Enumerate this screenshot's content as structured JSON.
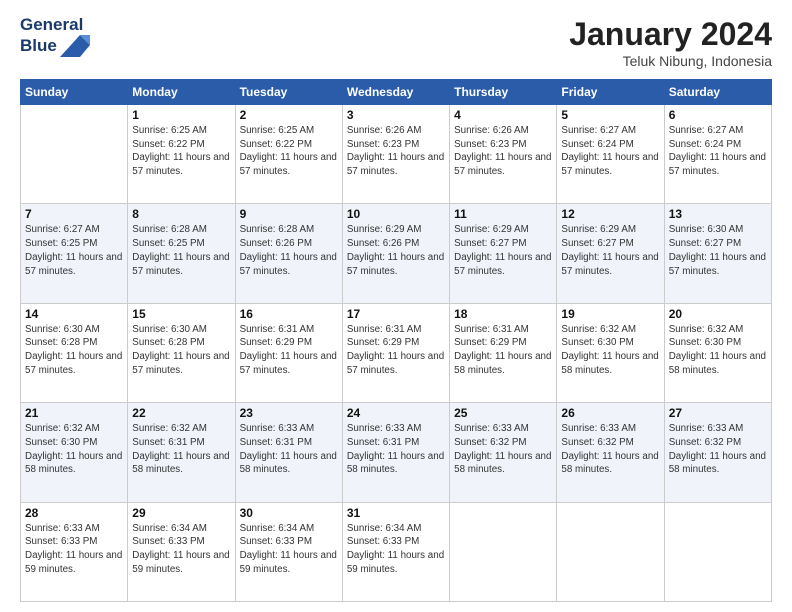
{
  "header": {
    "logo_line1": "General",
    "logo_line2": "Blue",
    "month": "January 2024",
    "location": "Teluk Nibung, Indonesia"
  },
  "days_of_week": [
    "Sunday",
    "Monday",
    "Tuesday",
    "Wednesday",
    "Thursday",
    "Friday",
    "Saturday"
  ],
  "weeks": [
    [
      {
        "day": "",
        "sunrise": "",
        "sunset": "",
        "daylight": ""
      },
      {
        "day": "1",
        "sunrise": "Sunrise: 6:25 AM",
        "sunset": "Sunset: 6:22 PM",
        "daylight": "Daylight: 11 hours and 57 minutes."
      },
      {
        "day": "2",
        "sunrise": "Sunrise: 6:25 AM",
        "sunset": "Sunset: 6:22 PM",
        "daylight": "Daylight: 11 hours and 57 minutes."
      },
      {
        "day": "3",
        "sunrise": "Sunrise: 6:26 AM",
        "sunset": "Sunset: 6:23 PM",
        "daylight": "Daylight: 11 hours and 57 minutes."
      },
      {
        "day": "4",
        "sunrise": "Sunrise: 6:26 AM",
        "sunset": "Sunset: 6:23 PM",
        "daylight": "Daylight: 11 hours and 57 minutes."
      },
      {
        "day": "5",
        "sunrise": "Sunrise: 6:27 AM",
        "sunset": "Sunset: 6:24 PM",
        "daylight": "Daylight: 11 hours and 57 minutes."
      },
      {
        "day": "6",
        "sunrise": "Sunrise: 6:27 AM",
        "sunset": "Sunset: 6:24 PM",
        "daylight": "Daylight: 11 hours and 57 minutes."
      }
    ],
    [
      {
        "day": "7",
        "sunrise": "Sunrise: 6:27 AM",
        "sunset": "Sunset: 6:25 PM",
        "daylight": "Daylight: 11 hours and 57 minutes."
      },
      {
        "day": "8",
        "sunrise": "Sunrise: 6:28 AM",
        "sunset": "Sunset: 6:25 PM",
        "daylight": "Daylight: 11 hours and 57 minutes."
      },
      {
        "day": "9",
        "sunrise": "Sunrise: 6:28 AM",
        "sunset": "Sunset: 6:26 PM",
        "daylight": "Daylight: 11 hours and 57 minutes."
      },
      {
        "day": "10",
        "sunrise": "Sunrise: 6:29 AM",
        "sunset": "Sunset: 6:26 PM",
        "daylight": "Daylight: 11 hours and 57 minutes."
      },
      {
        "day": "11",
        "sunrise": "Sunrise: 6:29 AM",
        "sunset": "Sunset: 6:27 PM",
        "daylight": "Daylight: 11 hours and 57 minutes."
      },
      {
        "day": "12",
        "sunrise": "Sunrise: 6:29 AM",
        "sunset": "Sunset: 6:27 PM",
        "daylight": "Daylight: 11 hours and 57 minutes."
      },
      {
        "day": "13",
        "sunrise": "Sunrise: 6:30 AM",
        "sunset": "Sunset: 6:27 PM",
        "daylight": "Daylight: 11 hours and 57 minutes."
      }
    ],
    [
      {
        "day": "14",
        "sunrise": "Sunrise: 6:30 AM",
        "sunset": "Sunset: 6:28 PM",
        "daylight": "Daylight: 11 hours and 57 minutes."
      },
      {
        "day": "15",
        "sunrise": "Sunrise: 6:30 AM",
        "sunset": "Sunset: 6:28 PM",
        "daylight": "Daylight: 11 hours and 57 minutes."
      },
      {
        "day": "16",
        "sunrise": "Sunrise: 6:31 AM",
        "sunset": "Sunset: 6:29 PM",
        "daylight": "Daylight: 11 hours and 57 minutes."
      },
      {
        "day": "17",
        "sunrise": "Sunrise: 6:31 AM",
        "sunset": "Sunset: 6:29 PM",
        "daylight": "Daylight: 11 hours and 57 minutes."
      },
      {
        "day": "18",
        "sunrise": "Sunrise: 6:31 AM",
        "sunset": "Sunset: 6:29 PM",
        "daylight": "Daylight: 11 hours and 58 minutes."
      },
      {
        "day": "19",
        "sunrise": "Sunrise: 6:32 AM",
        "sunset": "Sunset: 6:30 PM",
        "daylight": "Daylight: 11 hours and 58 minutes."
      },
      {
        "day": "20",
        "sunrise": "Sunrise: 6:32 AM",
        "sunset": "Sunset: 6:30 PM",
        "daylight": "Daylight: 11 hours and 58 minutes."
      }
    ],
    [
      {
        "day": "21",
        "sunrise": "Sunrise: 6:32 AM",
        "sunset": "Sunset: 6:30 PM",
        "daylight": "Daylight: 11 hours and 58 minutes."
      },
      {
        "day": "22",
        "sunrise": "Sunrise: 6:32 AM",
        "sunset": "Sunset: 6:31 PM",
        "daylight": "Daylight: 11 hours and 58 minutes."
      },
      {
        "day": "23",
        "sunrise": "Sunrise: 6:33 AM",
        "sunset": "Sunset: 6:31 PM",
        "daylight": "Daylight: 11 hours and 58 minutes."
      },
      {
        "day": "24",
        "sunrise": "Sunrise: 6:33 AM",
        "sunset": "Sunset: 6:31 PM",
        "daylight": "Daylight: 11 hours and 58 minutes."
      },
      {
        "day": "25",
        "sunrise": "Sunrise: 6:33 AM",
        "sunset": "Sunset: 6:32 PM",
        "daylight": "Daylight: 11 hours and 58 minutes."
      },
      {
        "day": "26",
        "sunrise": "Sunrise: 6:33 AM",
        "sunset": "Sunset: 6:32 PM",
        "daylight": "Daylight: 11 hours and 58 minutes."
      },
      {
        "day": "27",
        "sunrise": "Sunrise: 6:33 AM",
        "sunset": "Sunset: 6:32 PM",
        "daylight": "Daylight: 11 hours and 58 minutes."
      }
    ],
    [
      {
        "day": "28",
        "sunrise": "Sunrise: 6:33 AM",
        "sunset": "Sunset: 6:33 PM",
        "daylight": "Daylight: 11 hours and 59 minutes."
      },
      {
        "day": "29",
        "sunrise": "Sunrise: 6:34 AM",
        "sunset": "Sunset: 6:33 PM",
        "daylight": "Daylight: 11 hours and 59 minutes."
      },
      {
        "day": "30",
        "sunrise": "Sunrise: 6:34 AM",
        "sunset": "Sunset: 6:33 PM",
        "daylight": "Daylight: 11 hours and 59 minutes."
      },
      {
        "day": "31",
        "sunrise": "Sunrise: 6:34 AM",
        "sunset": "Sunset: 6:33 PM",
        "daylight": "Daylight: 11 hours and 59 minutes."
      },
      {
        "day": "",
        "sunrise": "",
        "sunset": "",
        "daylight": ""
      },
      {
        "day": "",
        "sunrise": "",
        "sunset": "",
        "daylight": ""
      },
      {
        "day": "",
        "sunrise": "",
        "sunset": "",
        "daylight": ""
      }
    ]
  ]
}
